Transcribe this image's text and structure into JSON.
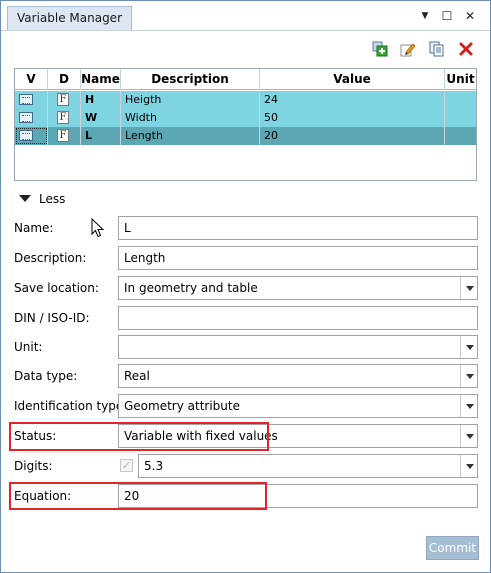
{
  "window": {
    "title": "Variable Manager",
    "menu_glyph": "▼",
    "maximize_glyph": "☐",
    "close_glyph": "✕"
  },
  "toolbar": {
    "icons": [
      "add-variable-icon",
      "edit-icon",
      "copy-icon",
      "delete-icon"
    ],
    "delete_color": "#d0201c"
  },
  "grid": {
    "columns": [
      "V",
      "D",
      "Name",
      "Description",
      "Value",
      "Unit"
    ],
    "rows": [
      {
        "d": "F",
        "name": "H",
        "description": "Heigth",
        "value": "24",
        "unit": ""
      },
      {
        "d": "F",
        "name": "W",
        "description": "Width",
        "value": "50",
        "unit": ""
      },
      {
        "d": "F",
        "name": "L",
        "description": "Length",
        "value": "20",
        "unit": "",
        "selected": true
      }
    ],
    "row_color": "#7fd4e2",
    "selected_row_color": "#5ba7b3"
  },
  "toggle": {
    "label": "Less"
  },
  "form": {
    "name_label": "Name:",
    "name_value": "L",
    "description_label": "Description:",
    "description_value": "Length",
    "save_location_label": "Save location:",
    "save_location_value": "In geometry and table",
    "din_label": "DIN / ISO-ID:",
    "din_value": "",
    "unit_label": "Unit:",
    "unit_value": "",
    "data_type_label": "Data type:",
    "data_type_value": "Real",
    "identification_label": "Identification type:",
    "identification_value": "Geometry attribute",
    "status_label": "Status:",
    "status_value": "Variable with fixed values",
    "digits_label": "Digits:",
    "digits_checked_glyph": "✓",
    "digits_value": "5.3",
    "equation_label": "Equation:",
    "equation_value": "20"
  },
  "highlight_color": "#e0262a",
  "commit_label": "Commit"
}
